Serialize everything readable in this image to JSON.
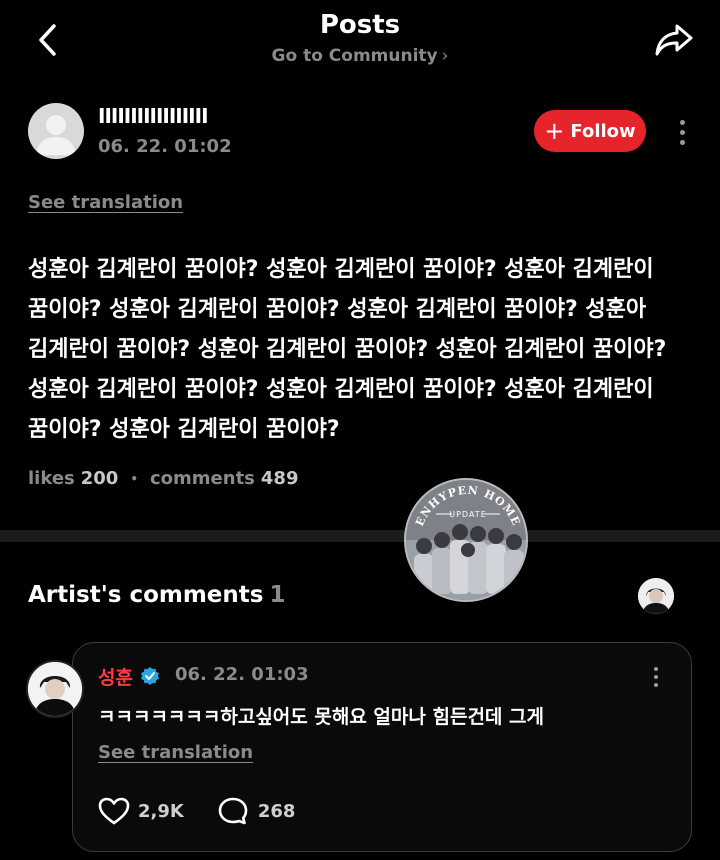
{
  "header": {
    "title": "Posts",
    "subtitle": "Go to Community",
    "subtitle_chevron": "›"
  },
  "post": {
    "username": "IIIIIIIIIIIIIIIII",
    "date": "06. 22. 01:02",
    "follow_label": "Follow",
    "see_translation": "See translation",
    "body": "성훈아 김계란이 꿈이야? 성훈아 김계란이 꿈이야? 성훈아 김계란이 꿈이야? 성훈아 김계란이 꿈이야? 성훈아 김계란이 꿈이야? 성훈아 김계란이 꿈이야? 성훈아 김계란이 꿈이야? 성훈아 김계란이 꿈이야? 성훈아 김계란이 꿈이야? 성훈아 김계란이 꿈이야? 성훈아 김계란이 꿈이야? 성훈아 김계란이 꿈이야?",
    "likes_label": "likes",
    "likes_count": "200",
    "separator": "•",
    "comments_label": "comments",
    "comments_count": "489"
  },
  "watermark": {
    "top_text": "ENHYPEN HOME",
    "badge_text": "UPDATE"
  },
  "artist_comments": {
    "heading": "Artist's comments",
    "count": "1"
  },
  "comment": {
    "author": "성훈",
    "date": "06. 22. 01:03",
    "text": "ㅋㅋㅋㅋㅋㅋㅋ하고싶어도 못해요 얼마나 힘든건데 그게",
    "see_translation": "See translation",
    "likes": "2,9K",
    "replies": "268"
  },
  "colors": {
    "background": "#000000",
    "accent_red": "#e5242b",
    "author_red": "#ff3b3f",
    "verified_blue": "#29a5e6",
    "muted": "#8a8a8a"
  },
  "icons": [
    "back-arrow-icon",
    "share-icon",
    "plus-icon",
    "more-vertical-icon",
    "verified-icon",
    "heart-icon",
    "comment-bubble-icon"
  ]
}
